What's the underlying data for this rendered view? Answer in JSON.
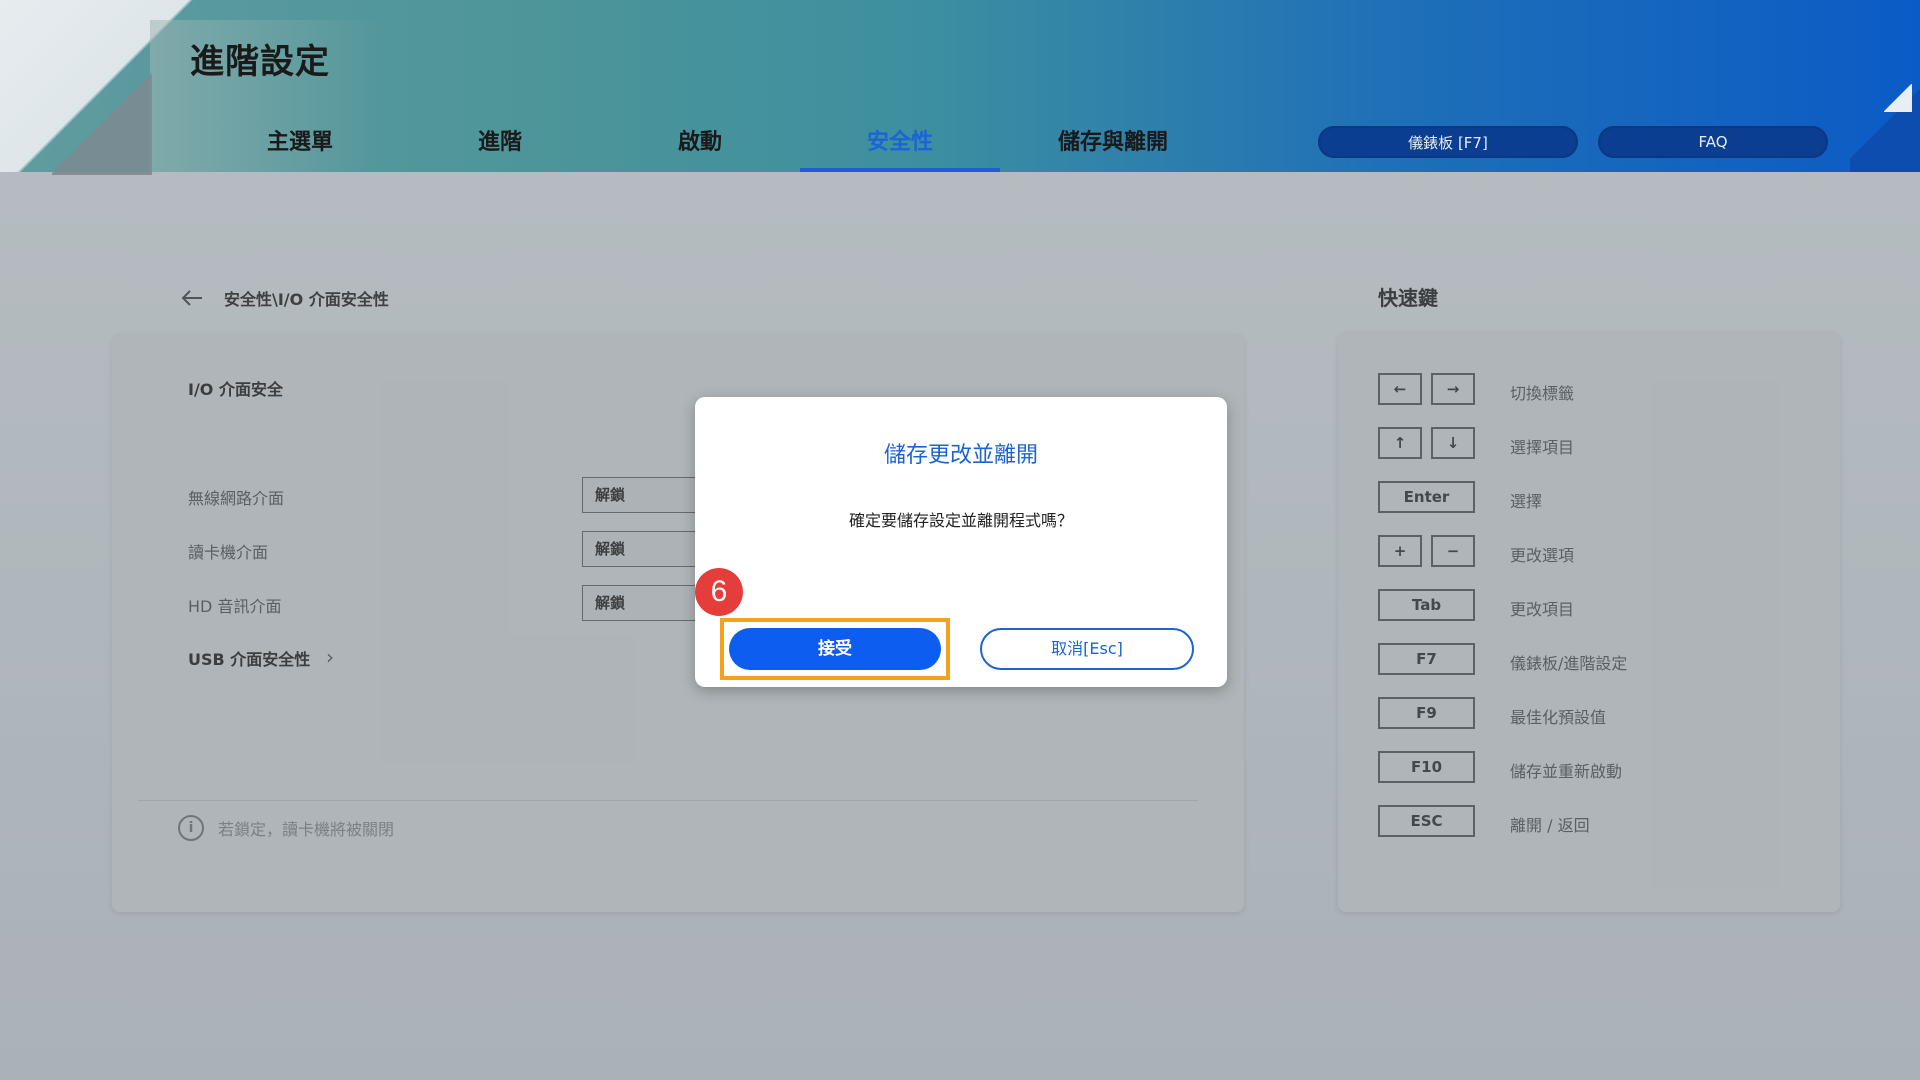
{
  "header": {
    "title": "進階設定",
    "tabs": [
      {
        "label": "主選單",
        "active": false
      },
      {
        "label": "進階",
        "active": false
      },
      {
        "label": "啟動",
        "active": false
      },
      {
        "label": "安全性",
        "active": true
      },
      {
        "label": "儲存與離開",
        "active": false
      }
    ],
    "dashboard_button": "儀錶板 [F7]",
    "faq_button": "FAQ"
  },
  "breadcrumb": "安全性\\I/O 介面安全性",
  "settings": {
    "section_title": "I/O 介面安全",
    "rows": [
      {
        "label": "無線網路介面",
        "value": "解鎖"
      },
      {
        "label": "讀卡機介面",
        "value": "解鎖"
      },
      {
        "label": "HD 音訊介面",
        "value": "解鎖"
      }
    ],
    "usb_link": "USB 介面安全性",
    "info_text": "若鎖定，讀卡機將被關閉"
  },
  "hotkeys": {
    "title": "快速鍵",
    "items": [
      {
        "keys": [
          "←",
          "→"
        ],
        "label": "切換標籤"
      },
      {
        "keys": [
          "↑",
          "↓"
        ],
        "label": "選擇項目"
      },
      {
        "keys": [
          "Enter"
        ],
        "label": "選擇"
      },
      {
        "keys": [
          "+",
          "−"
        ],
        "label": "更改選項"
      },
      {
        "keys": [
          "Tab"
        ],
        "label": "更改項目"
      },
      {
        "keys": [
          "F7"
        ],
        "label": "儀錶板/進階設定"
      },
      {
        "keys": [
          "F9"
        ],
        "label": "最佳化預設值"
      },
      {
        "keys": [
          "F10"
        ],
        "label": "儲存並重新啟動"
      },
      {
        "keys": [
          "ESC"
        ],
        "label": "離開 / 返回"
      }
    ]
  },
  "dialog": {
    "title": "儲存更改並離開",
    "message": "確定要儲存設定並離開程式嗎？",
    "accept": "接受",
    "cancel": "取消[Esc]"
  },
  "step_badge": "6",
  "colors": {
    "accent": "#1c63d3",
    "accept_button": "#0d5ef0",
    "highlight": "#f2a21c",
    "badge": "#e53c3c"
  }
}
